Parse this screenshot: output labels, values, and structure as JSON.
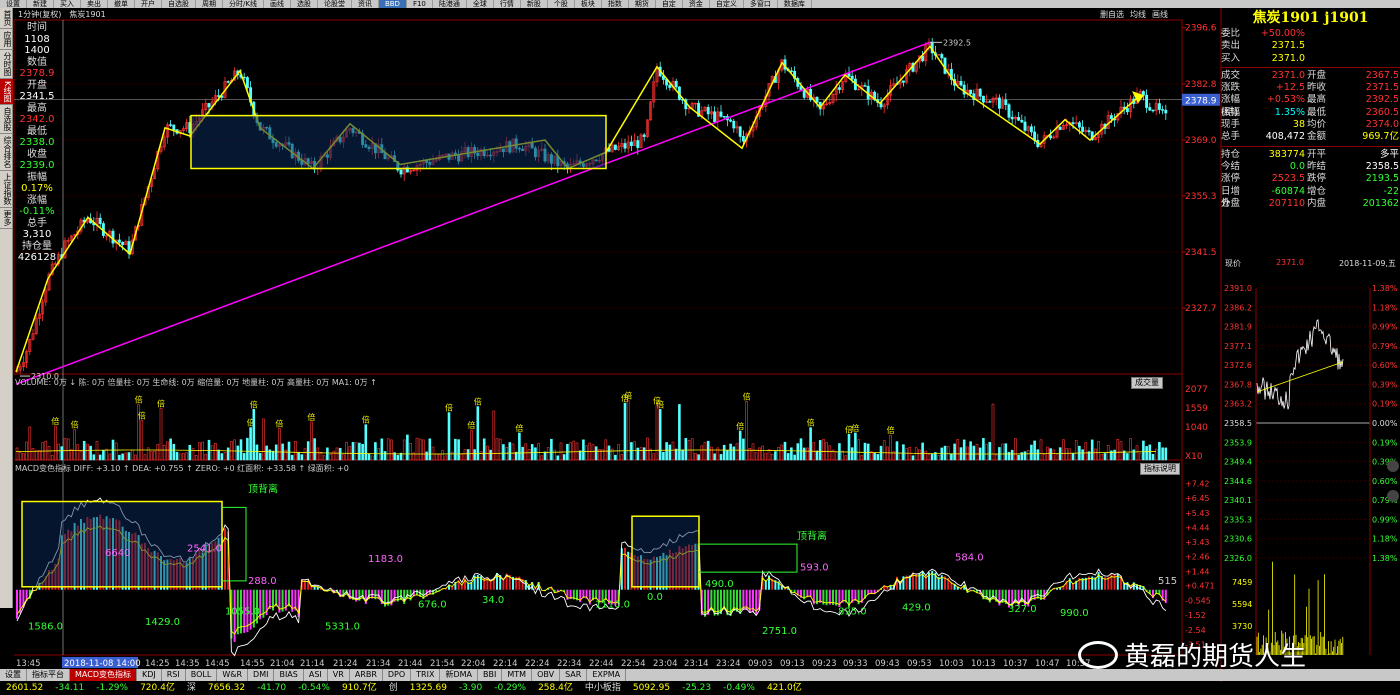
{
  "menubar": {
    "items": [
      "设置",
      "新建",
      "买入",
      "卖出",
      "撤单",
      "开户",
      "自选股",
      "周期",
      "分时/K线",
      "画线",
      "选股",
      "论股堂",
      "资讯",
      "BBD",
      "F10",
      "陆港通",
      "全球",
      "行情",
      "新股",
      "个股",
      "板块",
      "指数",
      "期货",
      "自定",
      "资金",
      "自定义",
      "多窗口",
      "数据库"
    ]
  },
  "leftnav": {
    "items": [
      "首页",
      "应用",
      "分时图",
      "K线图",
      "自选股",
      "综合排名",
      "上证指数",
      "更多"
    ]
  },
  "titlebar": {
    "period": "1分钟(复权)",
    "symbol": "焦炭1901",
    "tools": [
      "删自选",
      "均线",
      "画线"
    ]
  },
  "infocol": [
    {
      "label": "时间",
      "value": ""
    },
    {
      "label": "",
      "value": "1108"
    },
    {
      "label": "",
      "value": "1400"
    },
    {
      "label": "数值",
      "value": ""
    },
    {
      "label": "",
      "value": "2378.9"
    },
    {
      "label": "开盘",
      "value": ""
    },
    {
      "label": "",
      "value": "2341.5"
    },
    {
      "label": "最高",
      "value": ""
    },
    {
      "label": "",
      "value": "2342.0"
    },
    {
      "label": "最低",
      "value": ""
    },
    {
      "label": "",
      "value": "2338.0"
    },
    {
      "label": "收盘",
      "value": ""
    },
    {
      "label": "",
      "value": "2339.0"
    },
    {
      "label": "振幅",
      "value": ""
    },
    {
      "label": "",
      "value": "0.17%"
    },
    {
      "label": "涨幅",
      "value": ""
    },
    {
      "label": "",
      "value": "-0.11%"
    },
    {
      "label": "总手",
      "value": ""
    },
    {
      "label": "",
      "value": "3,310"
    },
    {
      "label": "持仓量",
      "value": ""
    },
    {
      "label": "",
      "value": "426128"
    }
  ],
  "mainchart": {
    "y_ticks": [
      "2396.6",
      "2382.8",
      "2369.0",
      "2355.3",
      "2341.5",
      "2327.7"
    ],
    "y_tick_values": [
      2396.6,
      2382.8,
      2369.0,
      2355.3,
      2341.5,
      2327.7
    ],
    "last_price_label": "2378.9",
    "high_label": "2392.5",
    "low_label": "2310.0",
    "ylim": [
      2312,
      2398
    ]
  },
  "volume": {
    "header": "VOLUME: 0万 ↓ 陈: 0万 倍量柱: 0万 生命线: 0万 缩倍量: 0万 地量柱: 0万 高量柱: 0万 MA1: 0万 ↑",
    "button": "成交量",
    "y_ticks": [
      "2077",
      "1559",
      "1040",
      "X10"
    ],
    "marker_label": "倍"
  },
  "macd": {
    "header": "MACD变色指标 DIFF: +3.10 ↑ DEA: +0.755 ↑ ZERO: +0 红面积: +33.58 ↑ 绿面积: +0",
    "button": "指标说明",
    "y_ticks": [
      "+7.42",
      "+6.45",
      "+5.43",
      "+4.44",
      "+3.43",
      "+2.46",
      "+1.44",
      "+0.471",
      "-0.545",
      "-1.52",
      "-2.54",
      "-3.51"
    ],
    "y_tick_values": [
      7.42,
      6.45,
      5.43,
      4.44,
      3.43,
      2.46,
      1.44,
      0.471,
      -0.545,
      -1.52,
      -2.54,
      -3.51
    ],
    "annotation_1": "顶背离",
    "annotation_2": "顶背离",
    "area_labels": [
      "1586.0",
      "6640",
      "1429.0",
      "2541.0",
      "1055.0",
      "288.0",
      "5331.0",
      "1183.0",
      "676.0",
      "34.0",
      "1110.0",
      "0.0",
      "490.0",
      "2751.0",
      "593.0",
      "895.0",
      "429.0",
      "584.0",
      "327.0",
      "990.0",
      "515"
    ]
  },
  "xaxis": {
    "labels": [
      "13:45",
      "2018-11-08 14:00",
      "14:25",
      "14:35",
      "14:45",
      "14:55",
      "21:04",
      "21:14",
      "21:24",
      "21:34",
      "21:44",
      "21:54",
      "22:04",
      "22:14",
      "22:24",
      "22:34",
      "22:44",
      "22:54",
      "23:04",
      "23:14",
      "23:24",
      "09:03",
      "09:13",
      "09:23",
      "09:33",
      "09:43",
      "09:53",
      "10:03",
      "10:13",
      "10:37",
      "10:47",
      "10:57"
    ]
  },
  "rightpanel": {
    "title": "焦炭1901 j1901",
    "rows": [
      {
        "l1": "委比",
        "v1": "+50.00%",
        "c1": "red",
        "l2": "",
        "v2": "",
        "c2": ""
      },
      {
        "l1": "卖出",
        "v1": "2371.5",
        "c1": "yel",
        "l2": "",
        "v2": "",
        "c2": ""
      },
      {
        "l1": "买入",
        "v1": "2371.0",
        "c1": "yel",
        "l2": "",
        "v2": "",
        "c2": ""
      },
      {
        "l1": "成交",
        "v1": "2371.0",
        "c1": "red",
        "l2": "开盘",
        "v2": "2367.5",
        "c2": "red"
      },
      {
        "l1": "涨跌",
        "v1": "+12.5",
        "c1": "red",
        "l2": "昨收",
        "v2": "2371.5",
        "c2": "red"
      },
      {
        "l1": "涨幅(结)",
        "v1": "+0.53%",
        "c1": "red",
        "l2": "最高",
        "v2": "2392.5",
        "c2": "red"
      },
      {
        "l1": "振幅",
        "v1": "1.35%",
        "c1": "cyan",
        "l2": "最低",
        "v2": "2360.5",
        "c2": "red"
      },
      {
        "l1": "现手",
        "v1": "38",
        "c1": "yel",
        "l2": "均价",
        "v2": "2374.0",
        "c2": "red"
      },
      {
        "l1": "总手",
        "v1": "408,472",
        "c1": "white",
        "l2": "金额",
        "v2": "969.7亿",
        "c2": "yel"
      },
      {
        "l1": "持仓",
        "v1": "383774",
        "c1": "yel",
        "l2": "开平",
        "v2": "多平",
        "c2": "white"
      },
      {
        "l1": "今结",
        "v1": "0.0",
        "c1": "green",
        "l2": "昨结",
        "v2": "2358.5",
        "c2": "white"
      },
      {
        "l1": "涨停",
        "v1": "2523.5",
        "c1": "red",
        "l2": "跌停",
        "v2": "2193.5",
        "c2": "green"
      },
      {
        "l1": "日增仓",
        "v1": "-60874",
        "c1": "green",
        "l2": "增仓",
        "v2": "-22",
        "c2": "green"
      },
      {
        "l1": "外盘",
        "v1": "207110",
        "c1": "red",
        "l2": "内盘",
        "v2": "201362",
        "c2": "green"
      }
    ],
    "foot": {
      "label": "现价",
      "price": "2371.0",
      "date": "2018-11-09,五"
    }
  },
  "minichart": {
    "left_ticks": [
      "2391.0",
      "2386.2",
      "2381.9",
      "2377.1",
      "2372.6",
      "2367.8",
      "2363.2",
      "2358.5",
      "2353.9",
      "2349.4",
      "2344.6",
      "2340.1",
      "2335.3",
      "2330.6",
      "2326.0"
    ],
    "right_ticks": [
      "1.38%",
      "1.18%",
      "0.99%",
      "0.79%",
      "0.60%",
      "0.39%",
      "0.19%",
      "0.00%",
      "0.19%",
      "0.39%",
      "0.60%",
      "0.79%",
      "0.99%",
      "1.18%",
      "1.38%"
    ],
    "vol_ticks": [
      "7459",
      "5594",
      "3730"
    ]
  },
  "bottombar": {
    "tabs": [
      "设置",
      "指标平台",
      "MACD变色指标",
      "KDJ",
      "RSI",
      "BOLL",
      "W&R",
      "DMI",
      "BIAS",
      "ASI",
      "VR",
      "ARBR",
      "DPO",
      "TRIX",
      "新DMA",
      "BBI",
      "MTM",
      "OBV",
      "SAR",
      "EXPMA"
    ],
    "selected": "MACD变色指标"
  },
  "statusbar": {
    "items": [
      {
        "t": "2601.52",
        "c": "yel"
      },
      {
        "t": "-34.11",
        "c": "green"
      },
      {
        "t": "-1.29%",
        "c": "green"
      },
      {
        "t": "720.4亿",
        "c": "yel"
      },
      {
        "t": "深",
        "c": "white"
      },
      {
        "t": "7656.32",
        "c": "yel"
      },
      {
        "t": "-41.70",
        "c": "green"
      },
      {
        "t": "-0.54%",
        "c": "green"
      },
      {
        "t": "910.7亿",
        "c": "yel"
      },
      {
        "t": "创",
        "c": "white"
      },
      {
        "t": "1325.69",
        "c": "yel"
      },
      {
        "t": "-3.90",
        "c": "green"
      },
      {
        "t": "-0.29%",
        "c": "green"
      },
      {
        "t": "258.4亿",
        "c": "yel"
      },
      {
        "t": "中小板指",
        "c": "white"
      },
      {
        "t": "5092.95",
        "c": "yel"
      },
      {
        "t": "-25.23",
        "c": "green"
      },
      {
        "t": "-0.49%",
        "c": "green"
      },
      {
        "t": "421.0亿",
        "c": "yel"
      }
    ]
  },
  "watermark": "黄磊的期货人生",
  "colors": {
    "up": "#ff3232",
    "down": "#54ffff",
    "yellow": "#ffff00",
    "magenta": "#ff00ff",
    "macd_up": "#e02020",
    "macd_down": "#54ffff",
    "macd_neg": "#33dd33",
    "macd_neg2": "#ff33ff"
  }
}
